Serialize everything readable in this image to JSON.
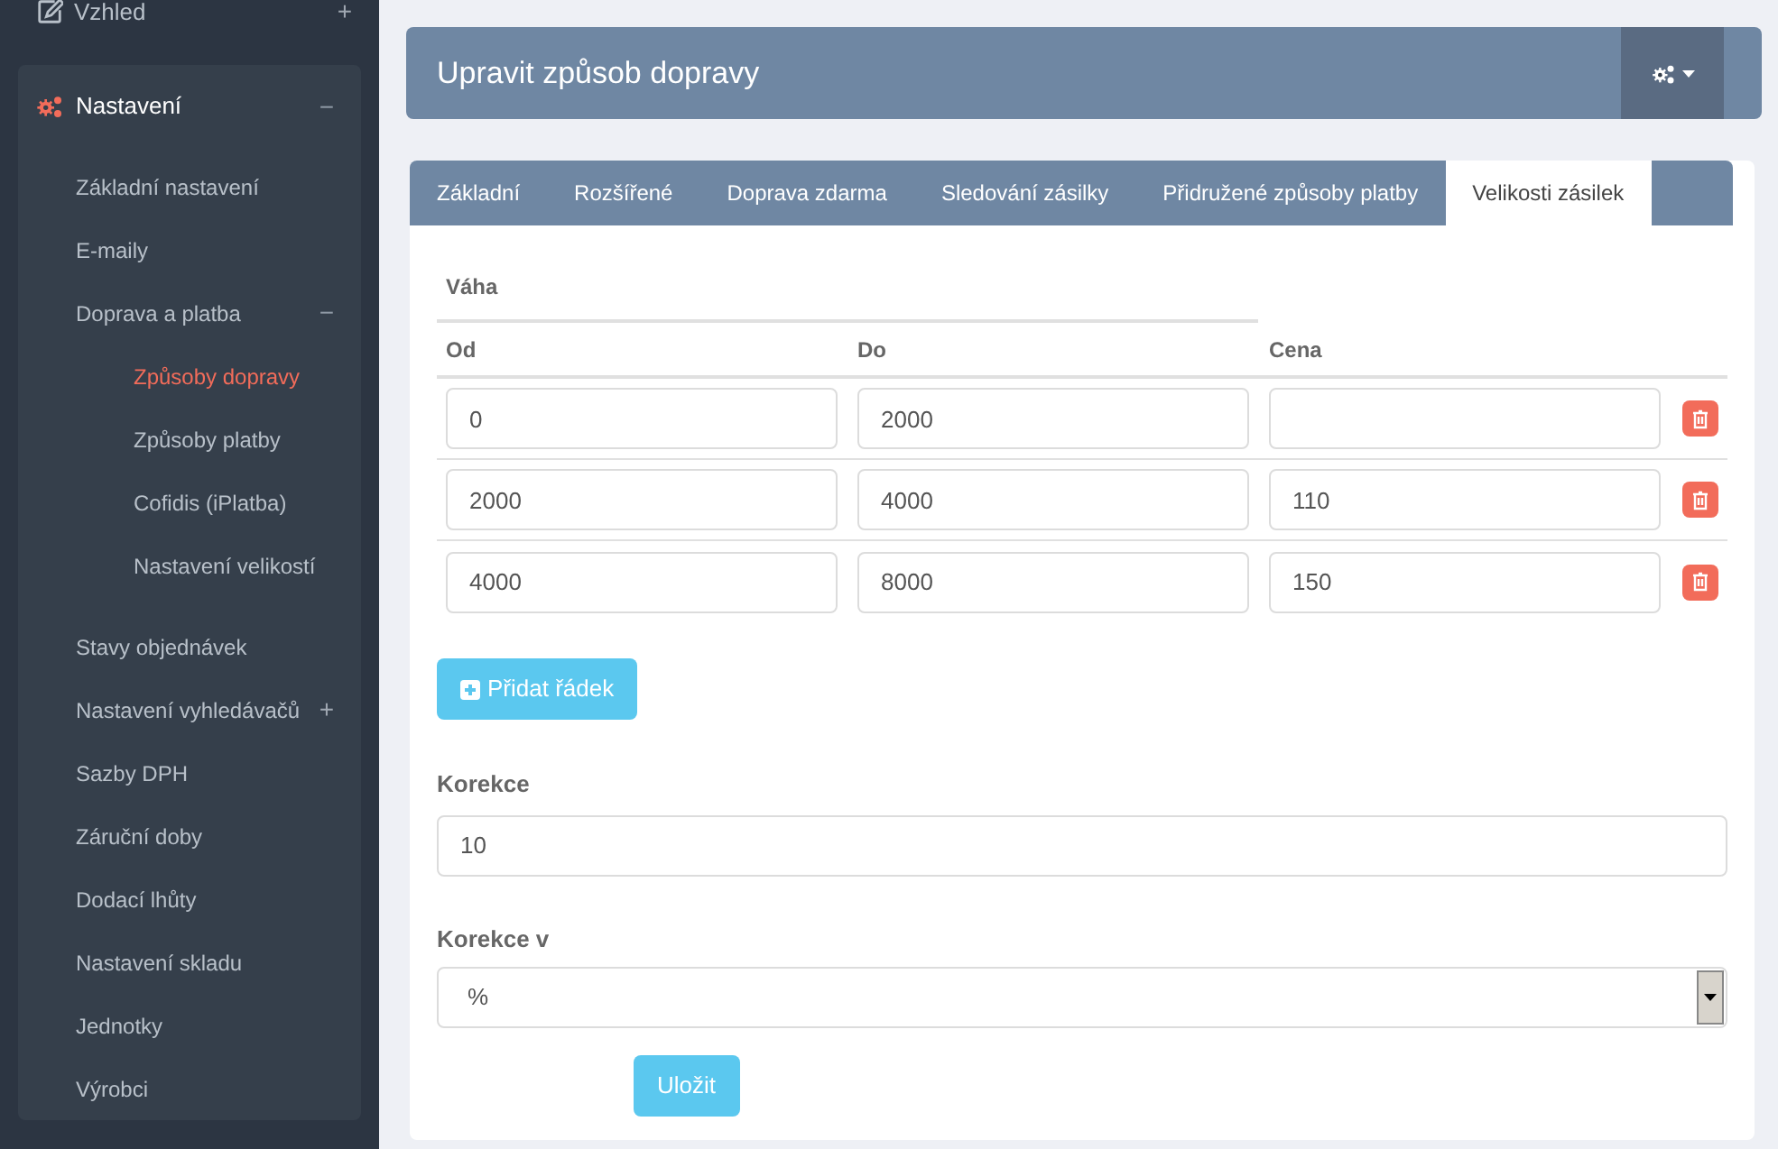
{
  "sidebar": {
    "sections": [
      {
        "label": "Vzhled",
        "toggle": "+",
        "expanded": false
      },
      {
        "label": "Nastavení",
        "toggle": "−",
        "expanded": true,
        "children": [
          {
            "label": "Základní nastavení",
            "selected": false
          },
          {
            "label": "E-maily",
            "selected": false
          },
          {
            "label": "Doprava a platba",
            "toggle": "−",
            "expanded": true,
            "selected": false,
            "children": [
              {
                "label": "Způsoby dopravy",
                "selected": true
              },
              {
                "label": "Způsoby platby",
                "selected": false
              },
              {
                "label": "Cofidis (iPlatba)",
                "selected": false
              },
              {
                "label": "Nastavení velikostí",
                "selected": false
              }
            ]
          },
          {
            "label": "Stavy objednávek",
            "selected": false
          },
          {
            "label": "Nastavení vyhledávačů",
            "toggle": "+",
            "expanded": false,
            "selected": false
          },
          {
            "label": "Sazby DPH",
            "selected": false
          },
          {
            "label": "Záruční doby",
            "selected": false
          },
          {
            "label": "Dodací lhůty",
            "selected": false
          },
          {
            "label": "Nastavení skladu",
            "selected": false
          },
          {
            "label": "Jednotky",
            "selected": false
          },
          {
            "label": "Výrobci",
            "selected": false
          }
        ]
      }
    ]
  },
  "header": {
    "title": "Upravit způsob dopravy"
  },
  "tabs": [
    {
      "label": "Základní",
      "selected": false
    },
    {
      "label": "Rozšířené",
      "selected": false
    },
    {
      "label": "Doprava zdarma",
      "selected": false
    },
    {
      "label": "Sledování zásilky",
      "selected": false
    },
    {
      "label": "Přidružené způsoby platby",
      "selected": false
    },
    {
      "label": "Velikosti zásilek",
      "selected": true
    }
  ],
  "table": {
    "group_heading": "Váha",
    "columns": [
      "Od",
      "Do",
      "Cena"
    ],
    "rows": [
      {
        "od": "0",
        "do": "2000",
        "cena": ""
      },
      {
        "od": "2000",
        "do": "4000",
        "cena": "110"
      },
      {
        "od": "4000",
        "do": "8000",
        "cena": "150"
      }
    ]
  },
  "add_row_button": "Přidat řádek",
  "correction": {
    "label": "Korekce",
    "value": "10"
  },
  "correction_unit": {
    "label": "Korekce v",
    "value": "%"
  },
  "save_button": "Uložit"
}
